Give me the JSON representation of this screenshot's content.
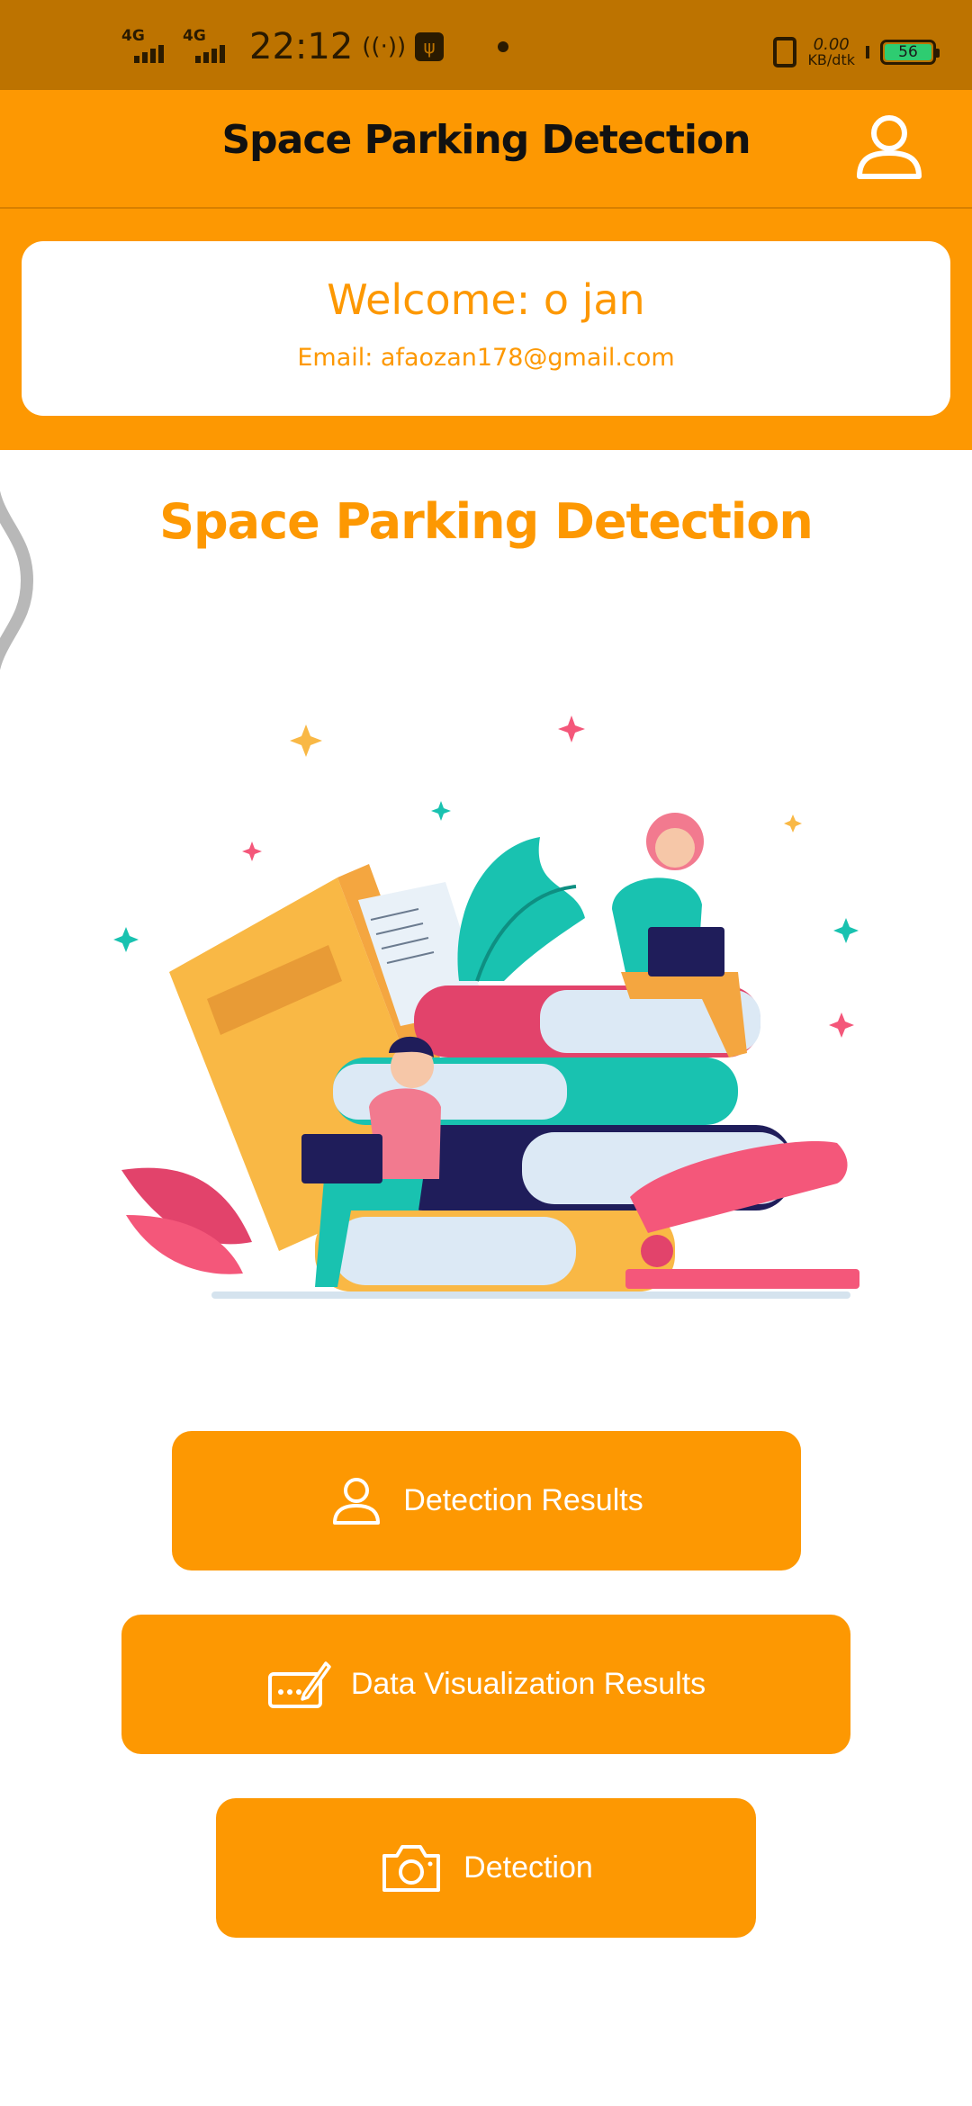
{
  "status_bar": {
    "network_1": "4G",
    "network_2": "4G",
    "time": "22:12",
    "speed_value": "0.00",
    "speed_unit": "KB/dtk",
    "battery": "56"
  },
  "app_bar": {
    "title": "Space Parking Detection",
    "profile_icon": "user-icon"
  },
  "welcome": {
    "title": "Welcome: o jan",
    "email": "Email: afaozan178@gmail.com"
  },
  "main": {
    "title": "Space Parking Detection"
  },
  "buttons": [
    {
      "label": "Detection Results",
      "icon": "user-icon"
    },
    {
      "label": "Data Visualization Results",
      "icon": "sign-pen-icon"
    },
    {
      "label": "Detection",
      "icon": "camera-icon"
    }
  ],
  "colors": {
    "status_bar": "#bd7300",
    "primary": "#fd9802",
    "card": "#ffffff"
  }
}
